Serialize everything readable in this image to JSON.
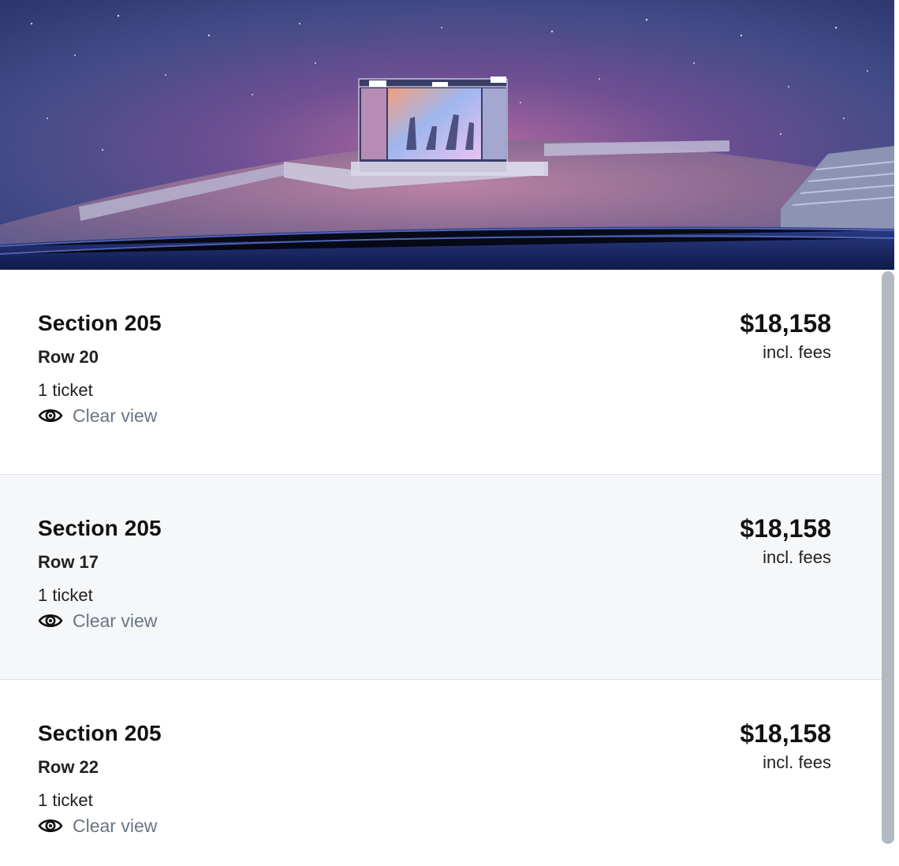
{
  "venue_view": {
    "image_icon": "stage-view-image",
    "colors": {
      "sky": "#3f4a86",
      "glow": "#9a4f86",
      "floor": "#7a5a86"
    }
  },
  "listings": [
    {
      "section": "Section 205",
      "row": "Row 20",
      "quantity": "1 ticket",
      "feature": "Clear view",
      "feature_icon": "eye-icon",
      "price": "$18,158",
      "price_note": "incl. fees"
    },
    {
      "section": "Section 205",
      "row": "Row 17",
      "quantity": "1 ticket",
      "feature": "Clear view",
      "feature_icon": "eye-icon",
      "price": "$18,158",
      "price_note": "incl. fees"
    },
    {
      "section": "Section 205",
      "row": "Row 22",
      "quantity": "1 ticket",
      "feature": "Clear view",
      "feature_icon": "eye-icon",
      "price": "$18,158",
      "price_note": "incl. fees"
    }
  ],
  "colors": {
    "muted_text": "#6b7582",
    "alt_row_bg": "#f5f7f9",
    "divider": "#dfe3e8",
    "scrollbar": "#b3b9c1"
  }
}
